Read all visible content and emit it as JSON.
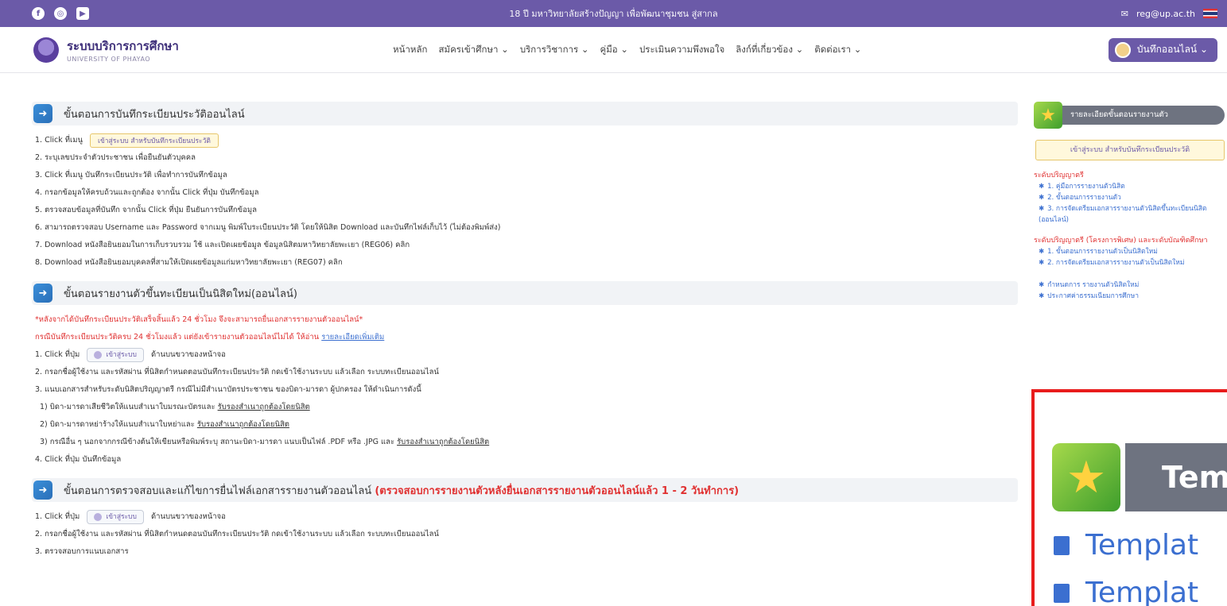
{
  "topbar": {
    "tagline": "18 ปี มหาวิทยาลัยสร้างปัญญา เพื่อพัฒนาชุมชน สู่สากล",
    "email": "reg@up.ac.th",
    "social_icons": [
      "facebook-icon",
      "instagram-icon",
      "youtube-icon"
    ]
  },
  "brand": {
    "name": "ระบบบริการการศึกษา",
    "sub": "UNIVERSITY OF PHAYAO"
  },
  "menu": [
    "หน้าหลัก",
    "สมัครเข้าศึกษา ⌄",
    "บริการวิชาการ ⌄",
    "คู่มือ ⌄",
    "ประเมินความพึงพอใจ",
    "ลิงก์ที่เกี่ยวข้อง ⌄",
    "ติดต่อเรา ⌄"
  ],
  "login_label": "บันทึกออนไลน์ ⌄",
  "section1": {
    "title": "ขั้นตอนการบันทึกระเบียนประวัติออนไลน์",
    "step1_pre": "1. Click ที่เมนู",
    "step1_pill": "เข้าสู่ระบบ สำหรับบันทึกระเบียนประวัติ",
    "step2": "2. ระบุเลขประจำตัวประชาชน เพื่อยืนยันตัวบุคคล",
    "step3": "3. Click ที่เมนู บันทึกระเบียนประวัติ เพื่อทำการบันทึกข้อมูล",
    "step4": "4. กรอกข้อมูลให้ครบถ้วนและถูกต้อง จากนั้น Click ที่ปุ่ม บันทึกข้อมูล",
    "step5": "5. ตรวจสอบข้อมูลที่บันทึก จากนั้น Click ที่ปุ่ม ยืนยันการบันทึกข้อมูล",
    "step6": "6. สามารถตรวจสอบ Username และ Password จากเมนู พิมพ์ใบระเบียนประวัติ โดยให้นิสิต Download และบันทึกไฟล์เก็บไว้ (ไม่ต้องพิมพ์ส่ง)",
    "step7": "7. Download หนังสือยินยอมในการเก็บรวบรวม ใช้ และเปิดเผยข้อมูล ข้อมูลนิสิตมหาวิทยาลัยพะเยา (REG06) คลิก",
    "step8": "8. Download หนังสือยินยอมบุคคลที่สามให้เปิดเผยข้อมูลแก่มหาวิทยาลัยพะเยา (REG07) คลิก"
  },
  "section2": {
    "title": "ขั้นตอนรายงานตัวขึ้นทะเบียนเป็นนิสิตใหม่(ออนไลน์)",
    "note1": "*หลังจากได้บันทึกระเบียนประวัติเสร็จสิ้นแล้ว 24 ชั่วโมง จึงจะสามารถยื่นเอกสารรายงานตัวออนไลน์*",
    "note2_pre": "กรณีบันทึกระเบียนประวัติครบ 24 ชั่วโมงแล้ว แต่ยังเข้ารายงานตัวออนไลน์ไม่ได้ ให้อ่าน",
    "note2_link": "รายละเอียดเพิ่มเติม",
    "step1_pre": "1. Click ที่ปุ่ม",
    "step1_btn": "เข้าสู่ระบบ",
    "step1_post": "ด้านบนขวาของหน้าจอ",
    "step2": "2. กรอกชื่อผู้ใช้งาน และรหัสผ่าน ที่นิสิตกำหนดตอนบันทึกระเบียนประวัติ กดเข้าใช้งานระบบ แล้วเลือก ระบบทะเบียนออนไลน์",
    "step3": "3. แนบเอกสารสำหรับระดับนิสิตปริญญาตรี กรณีไม่มีสำเนาบัตรประชาชน ของบิดา-มารดา ผู้ปกครอง ให้ดำเนินการดังนี้",
    "sub1_pre": "1) บิดา-มารดาเสียชีวิตให้แนบสำเนาใบมรณะบัตรและ",
    "sub1_link": "รับรองสำเนาถูกต้องโดยนิสิต",
    "sub2_pre": "2) บิดา-มารดาหย่าร้างให้แนบสำเนาใบหย่าและ",
    "sub2_link": "รับรองสำเนาถูกต้องโดยนิสิต",
    "sub3_pre": "3) กรณีอื่น ๆ นอกจากกรณีข้างต้นให้เขียนหรือพิมพ์ระบุ สถานะบิดา-มารดา แนบเป็นไฟล์ .PDF หรือ .JPG และ",
    "sub3_link": "รับรองสำเนาถูกต้องโดยนิสิต",
    "step4": "4. Click ที่ปุ่ม บันทึกข้อมูล"
  },
  "section3": {
    "title": "ขั้นตอนการตรวจสอบและแก้ไขการยื่นไฟล์เอกสารรายงานตัวออนไลน์",
    "title_red": "(ตรวจสอบการรายงานตัวหลังยื่นเอกสารรายงานตัวออนไลน์แล้ว 1 - 2 วันทำการ)",
    "step1_pre": "1. Click ที่ปุ่ม",
    "step1_btn": "เข้าสู่ระบบ",
    "step1_post": "ด้านบนขวาของหน้าจอ",
    "step2": "2. กรอกชื่อผู้ใช้งาน และรหัสผ่าน ที่นิสิตกำหนดตอนบันทึกระเบียนประวัติ กดเข้าใช้งานระบบ แล้วเลือก ระบบทะเบียนออนไลน์",
    "step3": "3. ตรวจสอบการแนบเอกสาร"
  },
  "sidebar": {
    "head": "รายละเอียดขั้นตอนรายงานตัว",
    "box": "เข้าสู่ระบบ สำหรับบันทึกระเบียนประวัติ",
    "cat1": "ระดับปริญญาตรี",
    "cat1_links": [
      "1. คู่มือการรายงานตัวนิสิต",
      "2. ขั้นตอนการรายงานตัว",
      "3. การจัดเตรียมเอกสารรายงานตัวนิสิตขึ้นทะเบียนนิสิต (ออนไลน์)"
    ],
    "cat2": "ระดับปริญญาตรี (โครงการพิเศษ) และระดับบัณฑิตศึกษา",
    "cat2_links": [
      "1. ขั้นตอนการรายงานตัวเป็นนิสิตใหม่",
      "2. การจัดเตรียมเอกสารรายงานตัวเป็นนิสิตใหม่"
    ],
    "other_links": [
      "กำหนดการ รายงานตัวนิสิตใหม่",
      "ประกาศค่าธรรมเนียมการศึกษา"
    ]
  },
  "popup": {
    "title_partial": "Tem",
    "rows": [
      "Templat",
      "Templat"
    ]
  },
  "colors": {
    "brand_purple": "#6b5aa8",
    "accent_red": "#e03131",
    "link_blue": "#3b6fd0",
    "popup_border": "#e81c1c"
  }
}
